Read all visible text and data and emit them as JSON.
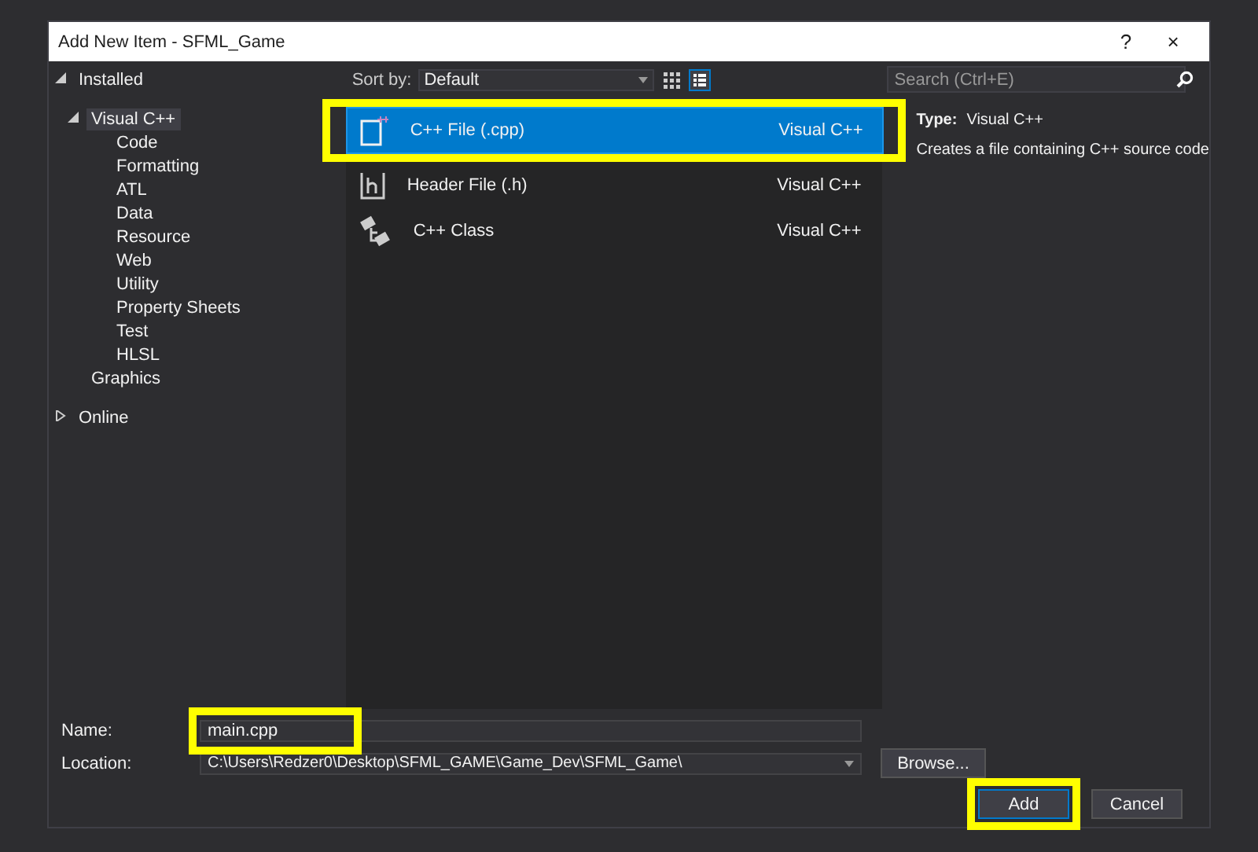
{
  "window": {
    "title": "Add New Item - SFML_Game",
    "help": "?",
    "close": "×"
  },
  "tree": [
    {
      "label": "Installed",
      "expanded": true,
      "selected": false,
      "children": [
        {
          "label": "Visual C++",
          "expanded": true,
          "selected": true,
          "children": [
            {
              "label": "Code",
              "selected": false
            },
            {
              "label": "Formatting",
              "selected": false
            },
            {
              "label": "ATL",
              "selected": false
            },
            {
              "label": "Data",
              "selected": false
            },
            {
              "label": "Resource",
              "selected": false
            },
            {
              "label": "Web",
              "selected": false
            },
            {
              "label": "Utility",
              "selected": false
            },
            {
              "label": "Property Sheets",
              "selected": false
            },
            {
              "label": "Test",
              "selected": false
            },
            {
              "label": "HLSL",
              "selected": false
            }
          ]
        },
        {
          "label": "Graphics",
          "selected": false
        }
      ]
    },
    {
      "label": "Online",
      "expanded": false,
      "selected": false
    }
  ],
  "sort": {
    "label": "Sort by:",
    "value": "Default"
  },
  "templates": [
    {
      "name": "C++ File (.cpp)",
      "category": "Visual C++",
      "kind": "cpp",
      "selected": true,
      "highlighted": true
    },
    {
      "name": "Header File (.h)",
      "category": "Visual C++",
      "kind": "header",
      "selected": false,
      "highlighted": false
    },
    {
      "name": "C++ Class",
      "category": "Visual C++",
      "kind": "class",
      "selected": false,
      "highlighted": false
    }
  ],
  "search": {
    "placeholder": "Search (Ctrl+E)"
  },
  "details": {
    "type_label": "Type:",
    "type_value": "Visual C++",
    "description": "Creates a file containing C++ source code"
  },
  "name": {
    "label": "Name:",
    "value": "main.cpp",
    "highlighted": true
  },
  "location": {
    "label": "Location:",
    "value": "C:\\Users\\Redzer0\\Desktop\\SFML_GAME\\Game_Dev\\SFML_Game\\"
  },
  "buttons": [
    {
      "label": "Browse...",
      "kind": "browse"
    },
    {
      "label": "Add",
      "kind": "add",
      "highlighted": true
    },
    {
      "label": "Cancel",
      "kind": "cancel"
    }
  ]
}
